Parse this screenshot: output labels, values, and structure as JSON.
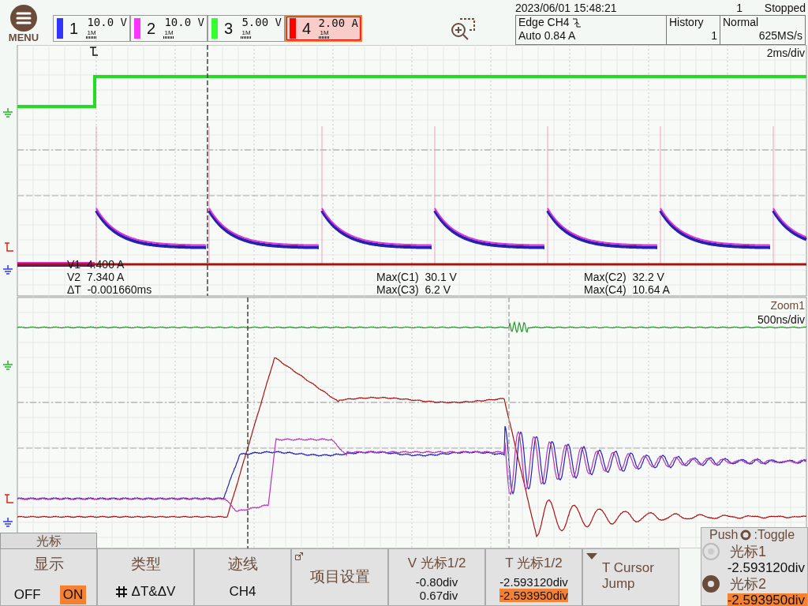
{
  "menu": {
    "label": "MENU"
  },
  "channels": [
    {
      "number": "1",
      "scale": "10.0 V",
      "coupling": "1M",
      "color": "#3333ff",
      "selected": false
    },
    {
      "number": "2",
      "scale": "10.0 V",
      "coupling": "1M",
      "color": "#ff33ff",
      "selected": false
    },
    {
      "number": "3",
      "scale": "5.00 V",
      "coupling": "1M",
      "color": "#33ff33",
      "selected": false
    },
    {
      "number": "4",
      "scale": "2.00 A",
      "coupling": "1M",
      "color": "#ff0000",
      "selected": true
    }
  ],
  "acquisition": {
    "datetime": "2023/06/01 15:48:21",
    "count": "1",
    "status": "Stopped",
    "trigger_type": "Edge CH4",
    "trigger_mode": "Auto 0.84 A",
    "history_label": "History",
    "history_value": "1",
    "mode": "Normal",
    "sample_rate": "625MS/s"
  },
  "main_plot": {
    "timebase": "2ms/div",
    "cursor_readouts": [
      "V1  4.400 A",
      "V2  7.340 A",
      "ΔT  -0.001660ms"
    ],
    "measurements": [
      {
        "label": "Max(C1)",
        "value": "30.1 V"
      },
      {
        "label": "Max(C3)",
        "value": "6.2 V"
      },
      {
        "label": "Max(C2)",
        "value": "32.2 V"
      },
      {
        "label": "Max(C4)",
        "value": "10.64 A"
      }
    ]
  },
  "zoom_plot": {
    "title": "Zoom1",
    "timebase": "500ns/div"
  },
  "softkeys": {
    "menu_title": "光标",
    "keys": [
      {
        "kind": "toggle",
        "title": "显示",
        "options": [
          {
            "label": "OFF",
            "selected": false
          },
          {
            "label": "ON",
            "selected": true
          }
        ]
      },
      {
        "kind": "type",
        "title": "类型",
        "value": "ΔT&ΔV"
      },
      {
        "kind": "value",
        "title": "迹线",
        "value": "CH4"
      },
      {
        "kind": "submenu",
        "title": "项目设置"
      },
      {
        "kind": "readout",
        "title": "V 光标1/2",
        "values": [
          {
            "text": "-0.80div",
            "selected": false
          },
          {
            "text": "0.67div",
            "selected": false
          }
        ]
      },
      {
        "kind": "readout",
        "title": "T 光标1/2",
        "values": [
          {
            "text": "-2.593120div",
            "selected": false
          },
          {
            "text": "-2.593950div",
            "selected": true
          }
        ]
      },
      {
        "kind": "action",
        "title": "T Cursor",
        "subtitle": "Jump"
      }
    ]
  },
  "knob_panel": {
    "push_label": "Push",
    "toggle_label": ":Toggle",
    "cursors": [
      {
        "label": "光标1",
        "value": "-2.593120div",
        "selected": false
      },
      {
        "label": "光标2",
        "value": "-2.593950div",
        "selected": true
      }
    ]
  }
}
